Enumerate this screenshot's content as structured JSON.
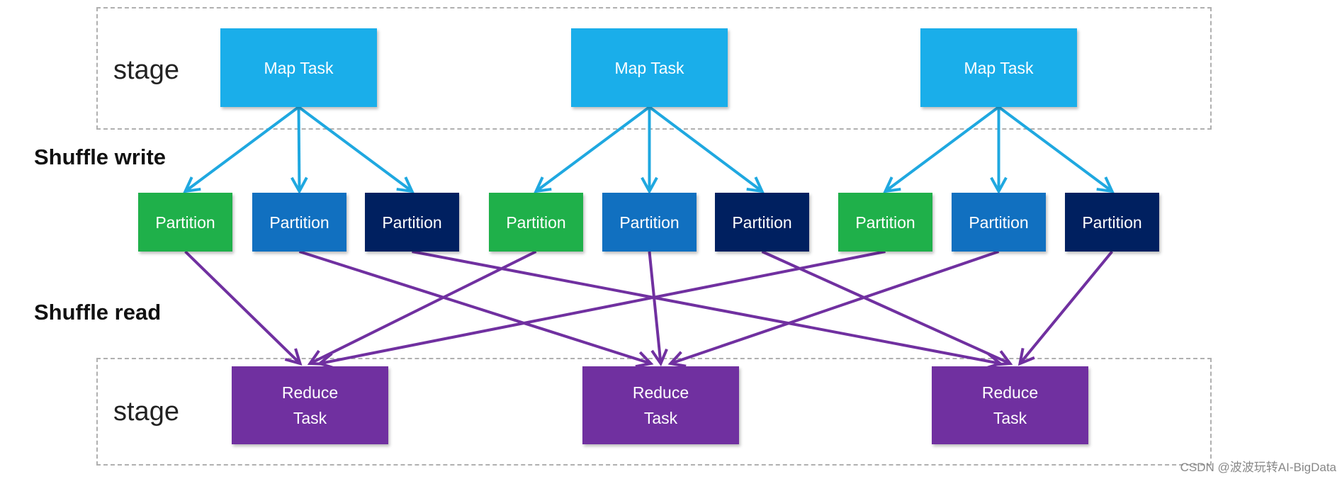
{
  "labels": {
    "stage_top": "stage",
    "stage_bottom": "stage",
    "shuffle_write": "Shuffle write",
    "shuffle_read": "Shuffle read"
  },
  "map_tasks": [
    {
      "label": "Map Task"
    },
    {
      "label": "Map Task"
    },
    {
      "label": "Map Task"
    }
  ],
  "partitions": [
    {
      "label": "Partition",
      "map": 0,
      "reduce": 0,
      "color": "#1fb04a"
    },
    {
      "label": "Partition",
      "map": 0,
      "reduce": 1,
      "color": "#1170c0"
    },
    {
      "label": "Partition",
      "map": 0,
      "reduce": 2,
      "color": "#002060"
    },
    {
      "label": "Partition",
      "map": 1,
      "reduce": 0,
      "color": "#1fb04a"
    },
    {
      "label": "Partition",
      "map": 1,
      "reduce": 1,
      "color": "#1170c0"
    },
    {
      "label": "Partition",
      "map": 1,
      "reduce": 2,
      "color": "#002060"
    },
    {
      "label": "Partition",
      "map": 2,
      "reduce": 0,
      "color": "#1fb04a"
    },
    {
      "label": "Partition",
      "map": 2,
      "reduce": 1,
      "color": "#1170c0"
    },
    {
      "label": "Partition",
      "map": 2,
      "reduce": 2,
      "color": "#002060"
    }
  ],
  "reduce_tasks": [
    {
      "label": "Reduce Task"
    },
    {
      "label": "Reduce Task"
    },
    {
      "label": "Reduce Task"
    }
  ],
  "colors": {
    "map": "#1aaeea",
    "reduce": "#7030a0",
    "write_arrow": "#1fa8e0",
    "read_arrow": "#7030a0"
  },
  "watermark": "CSDN @波波玩转AI-BigData"
}
